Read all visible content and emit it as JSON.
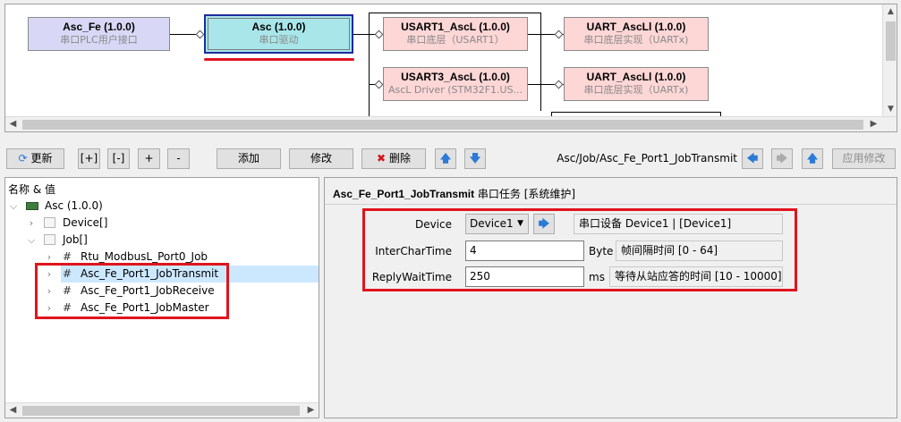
{
  "diagram": {
    "nodes": [
      {
        "id": "asc_fe",
        "title": "Asc_Fe (1.0.0)",
        "subtitle": "串口PLC用户接口"
      },
      {
        "id": "asc",
        "title": "Asc (1.0.0)",
        "subtitle": "串口驱动"
      },
      {
        "id": "usart1",
        "title": "USART1_AscL (1.0.0)",
        "subtitle": "串口底层（USART1）"
      },
      {
        "id": "uart_ascll_1",
        "title": "UART_AscLl (1.0.0)",
        "subtitle": "串口底层实现（UARTx)"
      },
      {
        "id": "usart3",
        "title": "USART3_AscL (1.0.0)",
        "subtitle": "AscL Driver (STM32F1.US..."
      },
      {
        "id": "uart_ascll_2",
        "title": "UART_AscLl (1.0.0)",
        "subtitle": "串口底层实现（UARTx)"
      }
    ],
    "colors": {
      "purple": "#d8d8f6",
      "cyan": "#a8e6ea",
      "pink": "#fdd6d6",
      "highlight": "#e0141e"
    }
  },
  "toolbar": {
    "refresh": "更新",
    "expand": "[+]",
    "collapse": "[-]",
    "plus": "+",
    "minus": "-",
    "add": "添加",
    "modify": "修改",
    "delete": "删除",
    "path": "Asc/Job/Asc_Fe_Port1_JobTransmit",
    "apply": "应用修改"
  },
  "tree": {
    "header": "名称 & 值",
    "root": "Asc (1.0.0)",
    "device": "Device[]",
    "job": "Job[]",
    "jobs": [
      "Rtu_ModbusL_Port0_Job",
      "Asc_Fe_Port1_JobTransmit",
      "Asc_Fe_Port1_JobReceive",
      "Asc_Fe_Port1_JobMaster"
    ]
  },
  "props": {
    "title": "Asc_Fe_Port1_JobTransmit",
    "title_suffix": "串口任务 [系统维护]",
    "fields": [
      {
        "label": "Device",
        "value": "Device1",
        "unit": "",
        "desc": "串口设备 Device1 | [Device1]"
      },
      {
        "label": "InterCharTime",
        "value": "4",
        "unit": "Byte",
        "desc": "帧间隔时间 [0 - 64]"
      },
      {
        "label": "ReplyWaitTime",
        "value": "250",
        "unit": "ms",
        "desc": "等待从站应答的时间 [10 - 10000]"
      }
    ]
  }
}
